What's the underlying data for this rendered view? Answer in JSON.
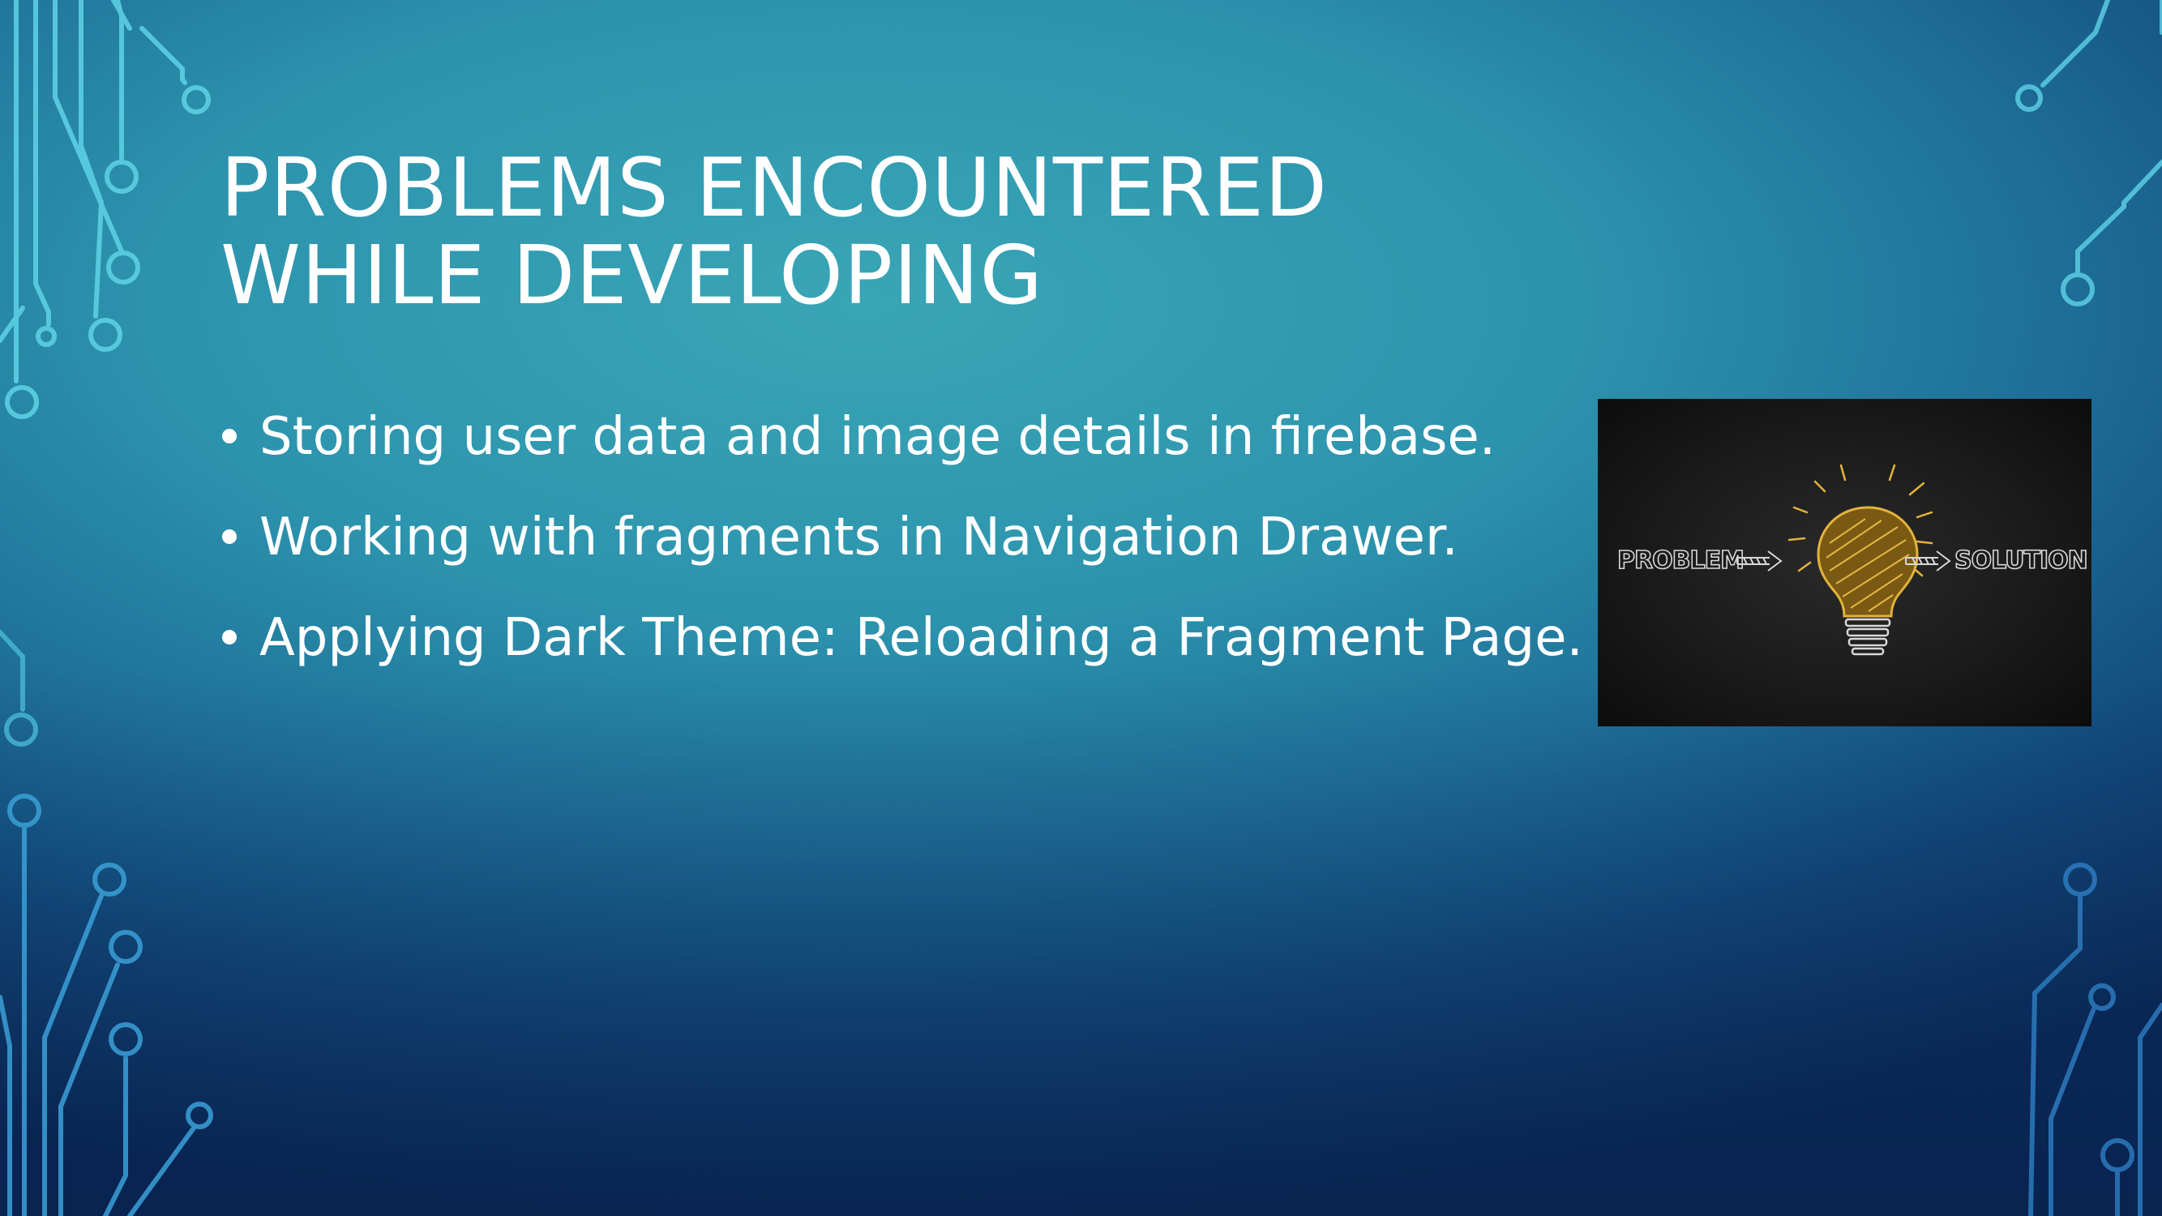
{
  "slide": {
    "title": "PROBLEMS ENCOUNTERED WHILE DEVELOPING",
    "bullets": [
      "Storing user data and image details in firebase.",
      "Working with fragments in Navigation Drawer.",
      "Applying Dark Theme: Reloading a Fragment Page."
    ],
    "picture": {
      "left_text": "PROBLEM",
      "right_text": "SOLUTION",
      "icon": "lightbulb-icon"
    }
  },
  "colors": {
    "background_top": "#39a6b6",
    "background_bottom": "#0b2c5c",
    "text": "#ffffff",
    "bulb": "#e3b33c"
  }
}
